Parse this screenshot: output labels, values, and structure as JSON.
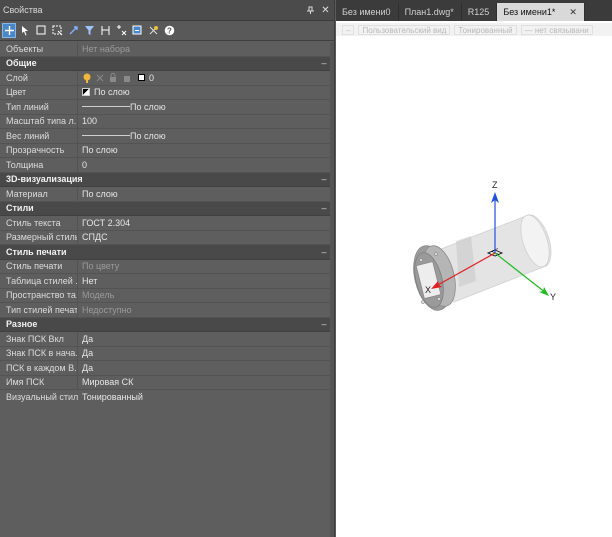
{
  "panel": {
    "title": "Свойства",
    "pin": "▾",
    "close": "✕",
    "objects_key": "Объекты",
    "objects_value": "Нет набора"
  },
  "sections": {
    "general": "Общие",
    "viz3d": "3D-визуализация",
    "styles": "Стили",
    "plot": "Стиль печати",
    "misc": "Разное",
    "collapse": "–"
  },
  "general": {
    "layer_k": "Слой",
    "layer_v": "0",
    "color_k": "Цвет",
    "color_v": "По слою",
    "linetype_k": "Тип линий",
    "linetype_v": "По слою",
    "ltscale_k": "Масштаб типа л...",
    "ltscale_v": "100",
    "lweight_k": "Вес линий",
    "lweight_v": "По слою",
    "transp_k": "Прозрачность",
    "transp_v": "По слою",
    "thick_k": "Толщина",
    "thick_v": "0"
  },
  "viz3d": {
    "material_k": "Материал",
    "material_v": "По слою"
  },
  "styles": {
    "text_k": "Стиль текста",
    "text_v": "ГОСТ 2.304",
    "dim_k": "Размерный стиль",
    "dim_v": "СПДС"
  },
  "plot": {
    "pstyle_k": "Стиль печати",
    "pstyle_v": "По цвету",
    "table_k": "Таблица стилей ...",
    "table_v": "Нет",
    "space_k": "Пространство та...",
    "space_v": "Модель",
    "type_k": "Тип стилей печати",
    "type_v": "Недоступно"
  },
  "misc": {
    "ucs_on_k": "Знак ПСК Вкл",
    "ucs_on_v": "Да",
    "ucs_origin_k": "Знак ПСК в нача...",
    "ucs_origin_v": "Да",
    "ucs_each_k": "ПСК в каждом В...",
    "ucs_each_v": "Да",
    "ucs_name_k": "Имя ПСК",
    "ucs_name_v": "Мировая СК",
    "vstyle_k": "Визуальный стиль",
    "vstyle_v": "Тонированный"
  },
  "tabs": [
    {
      "label": "Без имени0"
    },
    {
      "label": "План1.dwg*"
    },
    {
      "label": "R125"
    },
    {
      "label": "Без имени1*",
      "active": true
    }
  ],
  "tab_close": "✕",
  "viewbar": {
    "minus": "–",
    "view": "Пользовательский вид",
    "shade": "Тонированный",
    "link": "— нет связывани"
  },
  "axes": {
    "x": "X",
    "y": "Y",
    "z": "Z"
  },
  "icons": [
    "select-add-icon",
    "pointer-icon",
    "select-window-icon",
    "quick-select-icon",
    "toggle-pickadd-icon",
    "filter-icon",
    "selection-set-icon",
    "select-objects-icon",
    "similar-icon",
    "help-icon",
    "snap-toggle-icon"
  ],
  "colors": {
    "accent": "#4a87c6",
    "axis_x": "#e02020",
    "axis_y": "#22bb22",
    "axis_z": "#2050e0"
  }
}
